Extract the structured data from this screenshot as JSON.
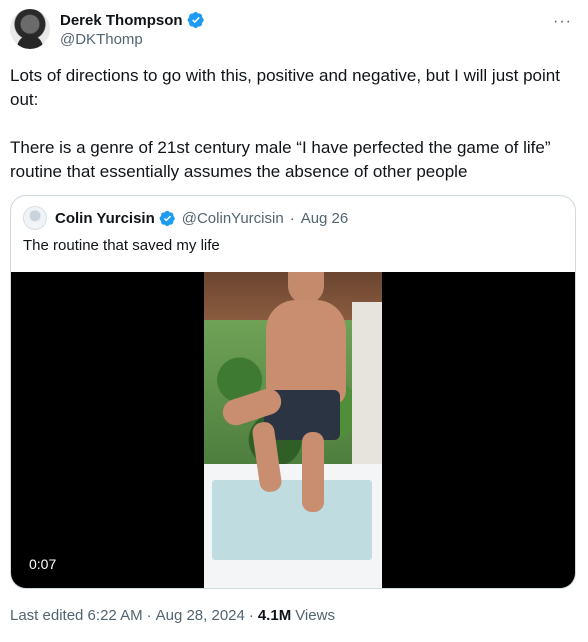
{
  "author": {
    "name": "Derek Thompson",
    "handle": "@DKThomp",
    "verified": true
  },
  "tweet": {
    "paragraphs": [
      "Lots of directions to go with this, positive and negative, but I will just point out:",
      "There is a genre of 21st century male “I have perfected the game of life” routine that essentially assumes the absence of other people"
    ]
  },
  "quote": {
    "name": "Colin Yurcisin",
    "handle": "@ColinYurcisin",
    "separator": "·",
    "date": "Aug 26",
    "verified": true,
    "text": "The routine that saved my life",
    "video_time": "0:07"
  },
  "meta": {
    "edited": "Last edited 6:22 AM",
    "sep1": "·",
    "date": "Aug 28, 2024",
    "sep2": "·",
    "views_count": "4.1M",
    "views_label": "Views"
  },
  "icons": {
    "more": "more-options-icon",
    "verified": "verified-badge-icon"
  },
  "colors": {
    "verified": "#1d9bf0",
    "secondary_text": "#536471",
    "border": "#cfd9de"
  }
}
